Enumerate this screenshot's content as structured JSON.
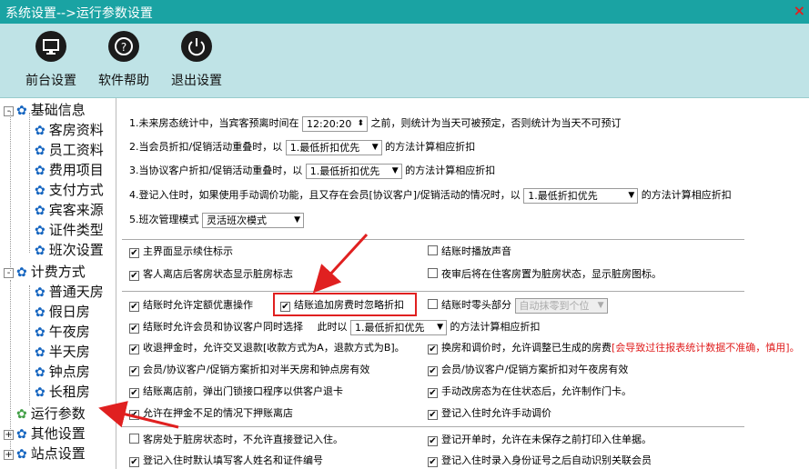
{
  "window": {
    "title": "系统设置-->运行参数设置",
    "close": "×"
  },
  "toolbar": [
    {
      "label": "前台设置",
      "icon": "monitor-icon"
    },
    {
      "label": "软件帮助",
      "icon": "help-icon"
    },
    {
      "label": "退出设置",
      "icon": "power-icon"
    }
  ],
  "tree": {
    "groups": [
      {
        "label": "基础信息",
        "expander": "-",
        "children": [
          "客房资料",
          "员工资料",
          "费用项目",
          "支付方式",
          "宾客来源",
          "证件类型",
          "班次设置"
        ]
      },
      {
        "label": "计费方式",
        "expander": "-",
        "children": [
          "普通天房",
          "假日房",
          "午夜房",
          "半天房",
          "钟点房",
          "长租房"
        ]
      }
    ],
    "selected": "运行参数",
    "others": [
      "其他设置",
      "站点设置"
    ]
  },
  "settings": {
    "r1_a": "1.未来房态统计中，当宾客预离时间在",
    "r1_time": "12:20:20",
    "r1_b": "之前，则统计为当天可被预定，否则统计为当天不可预订",
    "r2_a": "2.当会员折扣/促销活动重叠时，以",
    "r2_sel": "1.最低折扣优先",
    "r2_b": "的方法计算相应折扣",
    "r3_a": "3.当协议客户折扣/促销活动重叠时，以",
    "r3_sel": "1.最低折扣优先",
    "r3_b": "的方法计算相应折扣",
    "r4_a": "4.登记入住时，如果使用手动调价功能，且又存在会员[协议客户]/促销活动的情况时，以",
    "r4_sel": "1.最低折扣优先",
    "r4_b": "的方法计算相应折扣",
    "r5_a": "5.班次管理模式",
    "r5_sel": "灵活班次模式"
  },
  "checks": {
    "c1": "主界面显示续住标示",
    "c1_on": true,
    "c2": "结账时播放声音",
    "c2_on": false,
    "c3": "客人离店后客房状态显示脏房标志",
    "c3_on": true,
    "c4": "夜审后将在住客房置为脏房状态，显示脏房图标。",
    "c4_on": false,
    "c5": "结账时允许定额优惠操作",
    "c5_on": true,
    "c6": "结账追加房费时忽略折扣",
    "c6_on": true,
    "c7": "结账时零头部分",
    "c7_on": false,
    "c7_sel": "自动抹零到个位",
    "c8a": "结账时允许会员和协议客户同时选择",
    "c8_on": true,
    "c8b": "此时以",
    "c8_sel": "1.最低折扣优先",
    "c8c": "的方法计算相应折扣",
    "c9": "收退押金时，允许交叉退款[收款方式为A，退款方式为B]。",
    "c9_on": true,
    "c10": "换房和调价时，允许调整已生成的房费",
    "c10_on": true,
    "c10_red": "[会导致过往报表统计数据不准确，慎用]。",
    "c11": "会员/协议客户/促销方案折扣对半天房和钟点房有效",
    "c11_on": true,
    "c12": "会员/协议客户/促销方案折扣对午夜房有效",
    "c12_on": true,
    "c13": "结账离店前，弹出门锁接口程序以供客户退卡",
    "c13_on": true,
    "c14": "手动改房态为在住状态后，允许制作门卡。",
    "c14_on": true,
    "c15": "允许在押金不足的情况下押账离店",
    "c15_on": true,
    "c16": "登记入住时允许手动调价",
    "c16_on": true,
    "c17": "客房处于脏房状态时，不允许直接登记入住。",
    "c17_on": false,
    "c18": "登记开单时，允许在未保存之前打印入住单据。",
    "c18_on": true,
    "c19": "登记入住时默认填写客人姓名和证件编号",
    "c19_on": true,
    "c20": "登记入住时录入身份证号之后自动识别关联会员",
    "c20_on": true
  }
}
